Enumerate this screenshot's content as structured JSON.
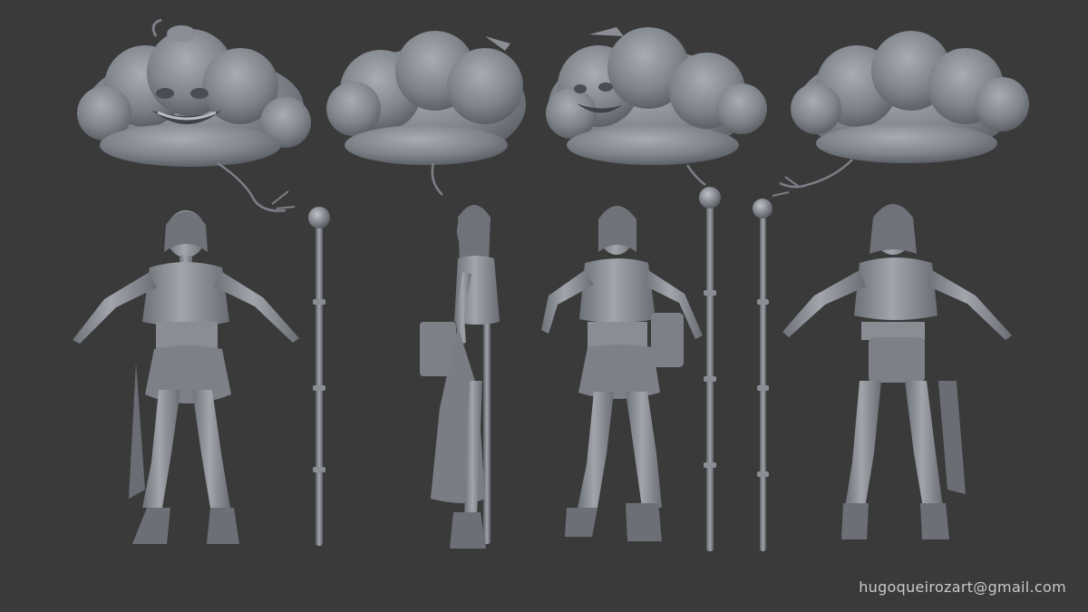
{
  "watermark": {
    "text": "hugoqueirozart@gmail.com"
  },
  "colors": {
    "background": "#3a3a3b",
    "model": "#8f949b",
    "model_dark": "#5e6268",
    "model_light": "#b6bac0",
    "watermark": "#c9c9c9"
  }
}
